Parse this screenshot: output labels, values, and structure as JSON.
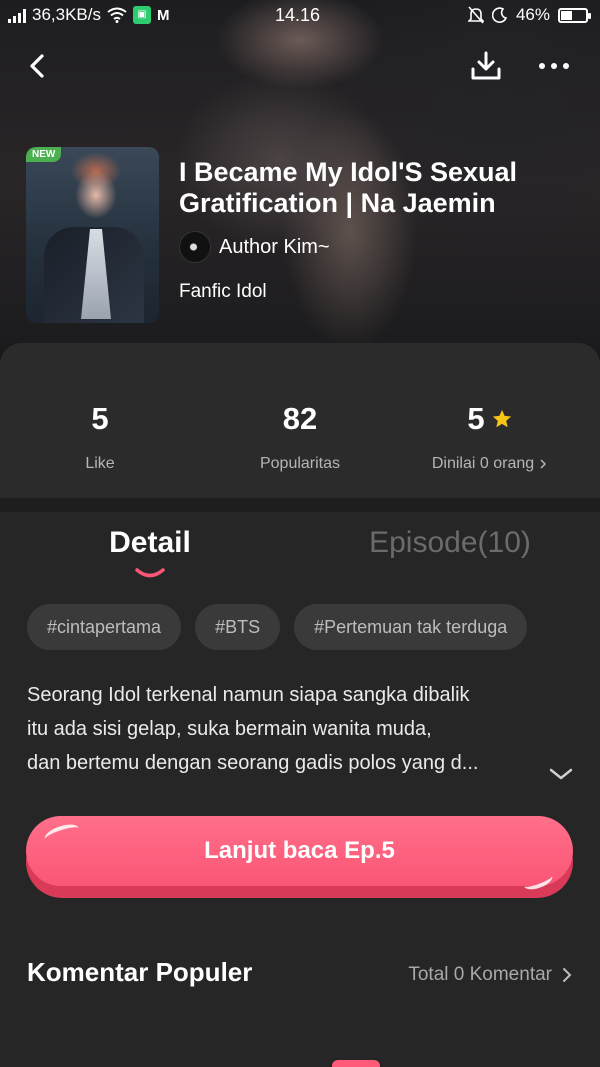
{
  "status_bar": {
    "network_speed": "36,3KB/s",
    "time": "14.16",
    "battery": "46%",
    "battery_level": 0.46
  },
  "nav": {
    "back_icon": "back-chevron-icon",
    "download_icon": "download-icon",
    "more_icon": "more-dots-icon"
  },
  "story": {
    "badge": "NEW",
    "title": "I Became My Idol'S Sexual Gratification | Na Jaemin",
    "author": "Author Kim~",
    "genre": "Fanfic Idol"
  },
  "stats": {
    "likes": {
      "value": "5",
      "label": "Like"
    },
    "popularity": {
      "value": "82",
      "label": "Popularitas"
    },
    "rating": {
      "value": "5",
      "label": "Dinilai 0 orang"
    }
  },
  "tabs": {
    "detail": "Detail",
    "episode": "Episode(10)"
  },
  "tags": [
    "#cintapertama",
    "#BTS",
    "#Pertemuan tak terduga"
  ],
  "synopsis": {
    "line1": "Seorang Idol terkenal namun siapa sangka dibalik",
    "line2": "itu ada sisi gelap, suka bermain wanita muda,",
    "line3": "dan bertemu dengan seorang gadis polos yang d..."
  },
  "cta": {
    "label": "Lanjut baca Ep.5"
  },
  "comments": {
    "title": "Komentar Populer",
    "total": "Total 0 Komentar"
  },
  "colors": {
    "accent": "#fb5675",
    "star": "#f5c518",
    "background": "#262626"
  }
}
